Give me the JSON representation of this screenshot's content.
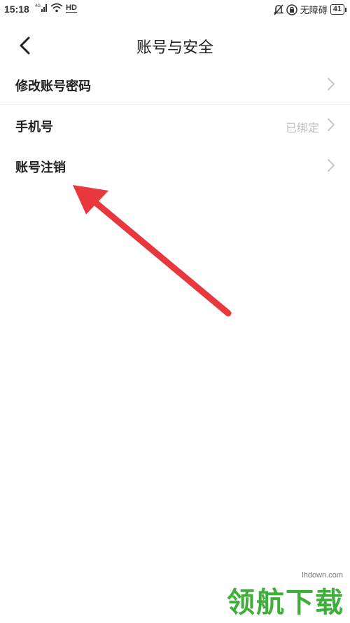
{
  "status_bar": {
    "time": "15:18",
    "network_badge": "4G",
    "hd_label": "HD",
    "accessibility_label": "无障碍",
    "battery_level": "41"
  },
  "header": {
    "title": "账号与安全"
  },
  "settings": {
    "items": [
      {
        "label": "修改账号密码",
        "value": ""
      },
      {
        "label": "手机号",
        "value": "已绑定"
      },
      {
        "label": "账号注销",
        "value": ""
      }
    ]
  },
  "watermark": {
    "url": "lhdown.com",
    "brand": "领航下载"
  },
  "colors": {
    "accent_arrow": "#e8383d",
    "watermark_green": "#3fae3a",
    "value_gray": "#bdbdbd"
  }
}
